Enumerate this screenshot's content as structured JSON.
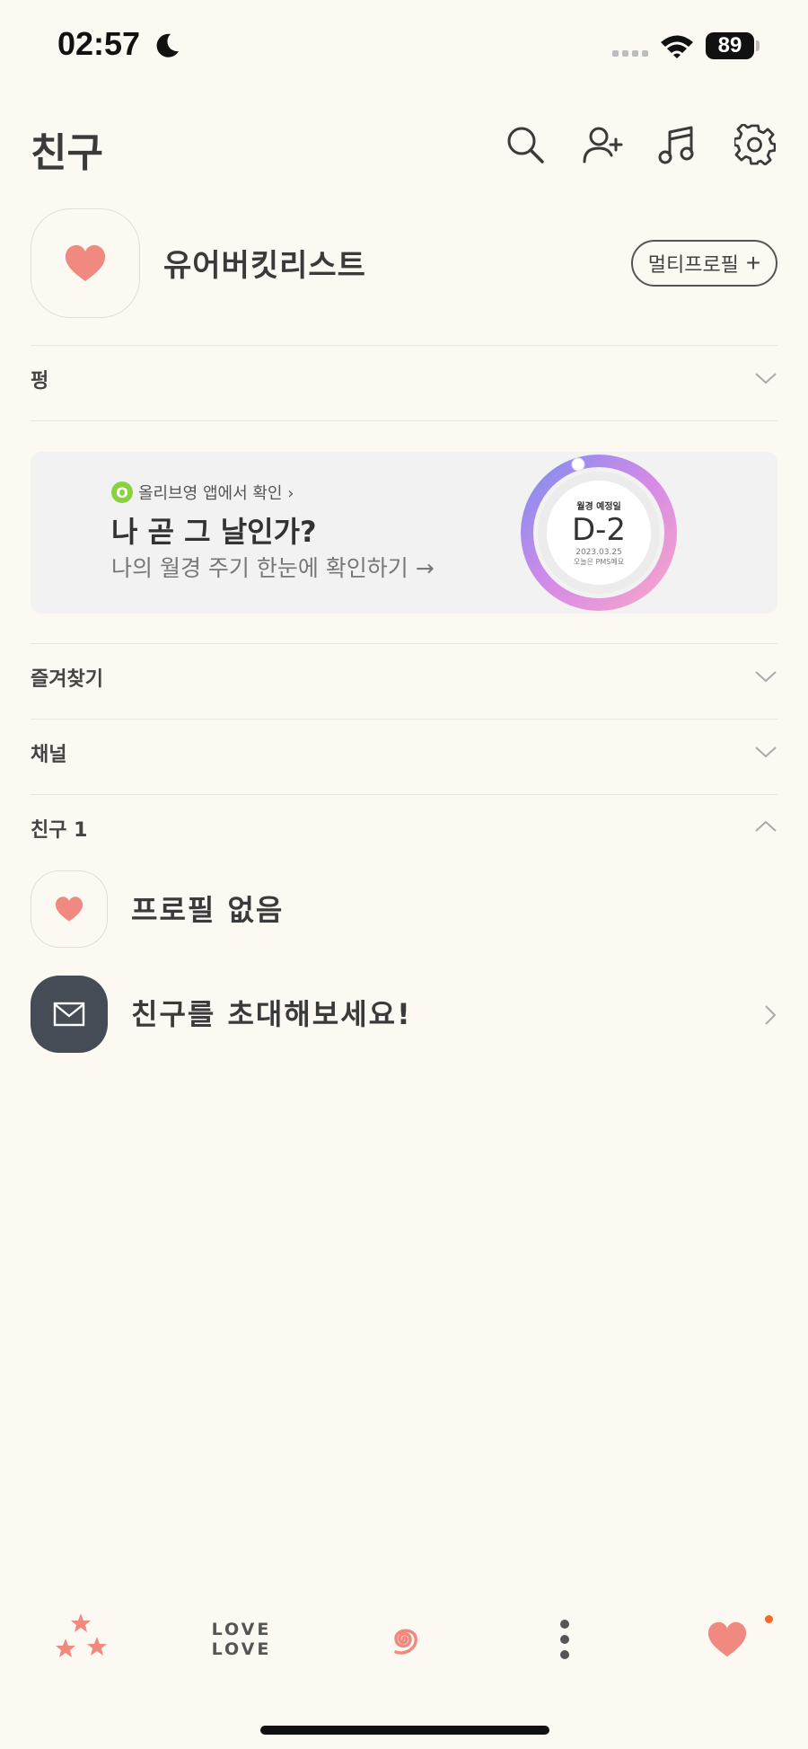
{
  "status_bar": {
    "time": "02:57",
    "battery": "89"
  },
  "header": {
    "title": "친구"
  },
  "my_profile": {
    "name": "유어버킷리스트",
    "multi_profile_label": "멀티프로필",
    "multi_profile_plus": "+"
  },
  "sections": {
    "updated": "펑",
    "favorites": "즐겨찾기",
    "channels": "채널",
    "friends": "친구 1"
  },
  "banner": {
    "logo_letter": "O",
    "source": "올리브영 앱에서 확인 ›",
    "title": "나 곧 그 날인가?",
    "subtitle": "나의 월경 주기 한눈에 확인하기 →",
    "ring_label": "월경 예정일",
    "ring_value": "D-2",
    "ring_date": "2023.03.25",
    "ring_note": "오늘은 PMS예요"
  },
  "friends": [
    {
      "name": "프로필 없음"
    },
    {
      "name": "친구를 초대해보세요!"
    }
  ],
  "tab_bar": {
    "love_text_1": "LOVE",
    "love_text_2": "LOVE"
  },
  "colors": {
    "background": "#fcf9f2",
    "heart": "#f08a80",
    "accent_badge": "#f06a2b",
    "envelope_bg": "#454c56"
  }
}
